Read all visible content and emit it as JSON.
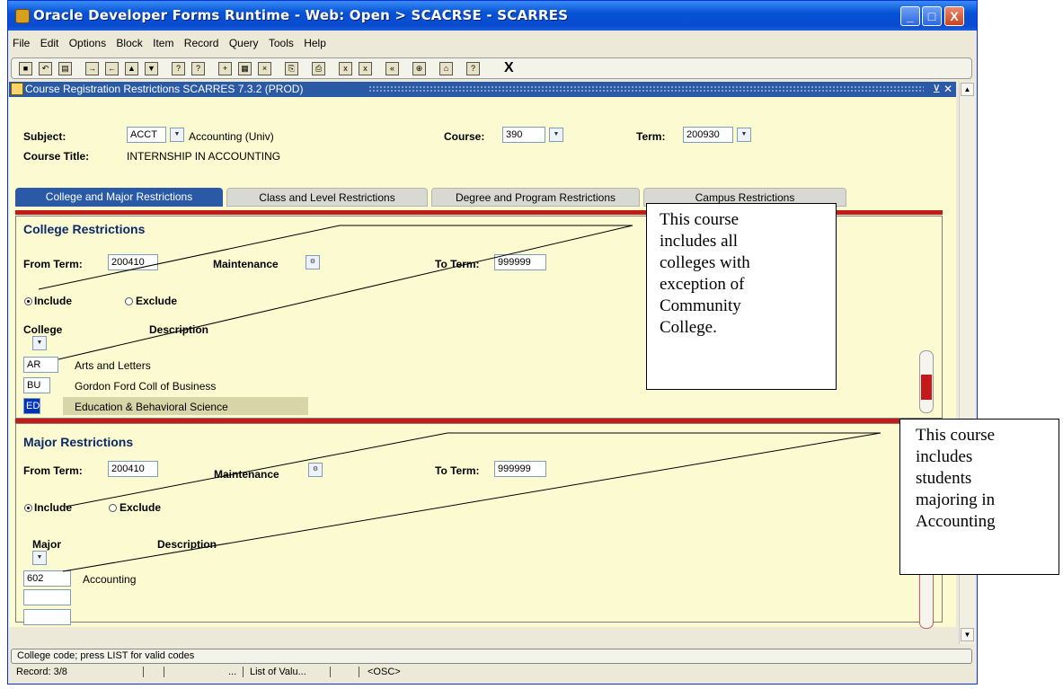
{
  "window": {
    "title": "Oracle Developer Forms Runtime - Web:  Open > SCACRSE - SCARRES",
    "controls": {
      "minimize": "_",
      "maximize": "□",
      "close": "X"
    }
  },
  "menu": [
    "File",
    "Edit",
    "Options",
    "Block",
    "Item",
    "Record",
    "Query",
    "Tools",
    "Help"
  ],
  "toolbar": {
    "exit_label": "X"
  },
  "form": {
    "title": "Course Registration Restrictions  SCARRES  7.3.2  (PROD)",
    "controls": "⊻ ✕",
    "subject_label": "Subject:",
    "subject_value": "ACCT",
    "subject_desc": "Accounting (Univ)",
    "course_title_label": "Course Title:",
    "course_title_value": "INTERNSHIP IN ACCOUNTING",
    "course_label": "Course:",
    "course_value": "390",
    "term_label": "Term:",
    "term_value": "200930"
  },
  "tabs": [
    {
      "label": "College and Major Restrictions",
      "active": true
    },
    {
      "label": "Class and Level Restrictions",
      "active": false
    },
    {
      "label": "Degree and Program Restrictions",
      "active": false
    },
    {
      "label": "Campus Restrictions",
      "active": false
    }
  ],
  "college": {
    "title": "College Restrictions",
    "from_term_label": "From Term:",
    "from_term_value": "200410",
    "maintenance_label": "Maintenance",
    "to_term_label": "To Term:",
    "to_term_value": "999999",
    "include_label": "Include",
    "exclude_label": "Exclude",
    "selected": "include",
    "col_code": "College",
    "col_desc": "Description",
    "rows": [
      {
        "code": "AR",
        "desc": "Arts and Letters"
      },
      {
        "code": "BU",
        "desc": "Gordon Ford Coll of Business"
      },
      {
        "code": "ED",
        "desc": "Education & Behavioral Science"
      }
    ]
  },
  "major": {
    "title": "Major  Restrictions",
    "from_term_label": "From Term:",
    "from_term_value": "200410",
    "maintenance_label": "Maintenance",
    "to_term_label": "To Term:",
    "to_term_value": "999999",
    "include_label": "Include",
    "exclude_label": "Exclude",
    "selected": "include",
    "col_code": "Major",
    "col_desc": "Description",
    "rows": [
      {
        "code": "602",
        "desc": "Accounting"
      }
    ]
  },
  "callouts": {
    "college": [
      "This course",
      "includes all",
      "colleges with",
      "exception of",
      "Community",
      "College."
    ],
    "major": [
      "This course",
      "includes",
      "students",
      "majoring in",
      "Accounting"
    ]
  },
  "status": {
    "hint": "College code; press LIST for valid codes",
    "record": "Record: 3/8",
    "ellipsis": "...",
    "lov": "List of Valu...",
    "osc": "<OSC>"
  }
}
